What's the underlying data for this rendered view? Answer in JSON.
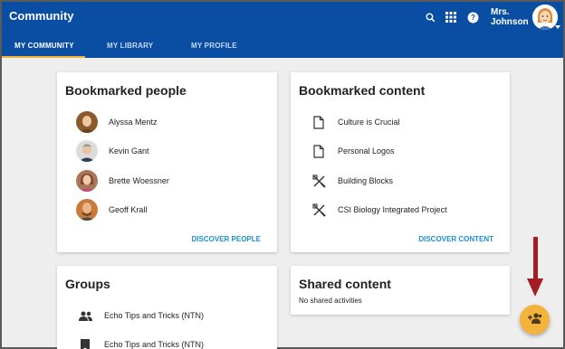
{
  "app": {
    "title": "Community"
  },
  "user": {
    "name_line1": "Mrs.",
    "name_line2": "Johnson"
  },
  "icons": {
    "search": "search-icon",
    "apps": "apps-grid-icon",
    "help": "help-icon"
  },
  "tabs": [
    {
      "label": "MY COMMUNITY",
      "active": true
    },
    {
      "label": "MY LIBRARY",
      "active": false
    },
    {
      "label": "MY PROFILE",
      "active": false
    }
  ],
  "bookmarked_people": {
    "title": "Bookmarked people",
    "people": [
      {
        "name": "Alyssa Mentz"
      },
      {
        "name": "Kevin Gant"
      },
      {
        "name": "Brette Woessner"
      },
      {
        "name": "Geoff Krall"
      }
    ],
    "link": "DISCOVER PEOPLE"
  },
  "bookmarked_content": {
    "title": "Bookmarked content",
    "items": [
      {
        "title": "Culture is Crucial",
        "icon": "document-icon"
      },
      {
        "title": "Personal Logos",
        "icon": "document-icon"
      },
      {
        "title": "Building Blocks",
        "icon": "tools-icon"
      },
      {
        "title": "CSI Biology Integrated Project",
        "icon": "tools-icon"
      }
    ],
    "link": "DISCOVER CONTENT"
  },
  "groups": {
    "title": "Groups",
    "items": [
      {
        "name": "Echo Tips and Tricks (NTN)",
        "icon": "people-icon"
      },
      {
        "name": "Echo Tips and Tricks (NTN)",
        "icon": "bookmark-icon"
      }
    ]
  },
  "shared_content": {
    "title": "Shared content",
    "empty_text": "No shared activities"
  },
  "colors": {
    "header": "#0a4ea3",
    "accent": "#f2b233",
    "link": "#1a8fd8",
    "fab": "#f4b33a",
    "annotation_arrow": "#a51d24"
  }
}
